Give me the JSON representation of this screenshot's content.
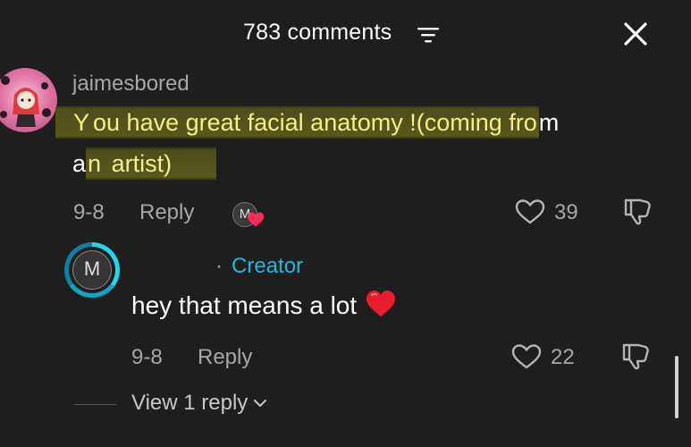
{
  "header": {
    "title": "783 comments",
    "filter_icon": "filter-icon",
    "close_icon": "close-icon"
  },
  "comments": [
    {
      "username": "jaimesbored",
      "text_line1_a": "Y",
      "text_line1_b": "ou have great facial anatomy !(coming fro",
      "text_line1_c": "m",
      "text_line2_a": "a",
      "text_line2_b": "n",
      "text_line2_c": " artist)",
      "date": "9-8",
      "reply_label": "Reply",
      "creator_like_initial": "M",
      "like_count": "39"
    }
  ],
  "reply": {
    "avatar_initial": "M",
    "dot": "·",
    "creator_label": "Creator",
    "text": "hey that means a lot",
    "date": "9-8",
    "reply_label": "Reply",
    "like_count": "22",
    "view_replies_label": "View 1 reply"
  },
  "colors": {
    "background": "#1e1e1e",
    "highlight_text": "#f3f08a",
    "creator_accent": "#20b8d8",
    "heart_red": "#fe2c55"
  }
}
